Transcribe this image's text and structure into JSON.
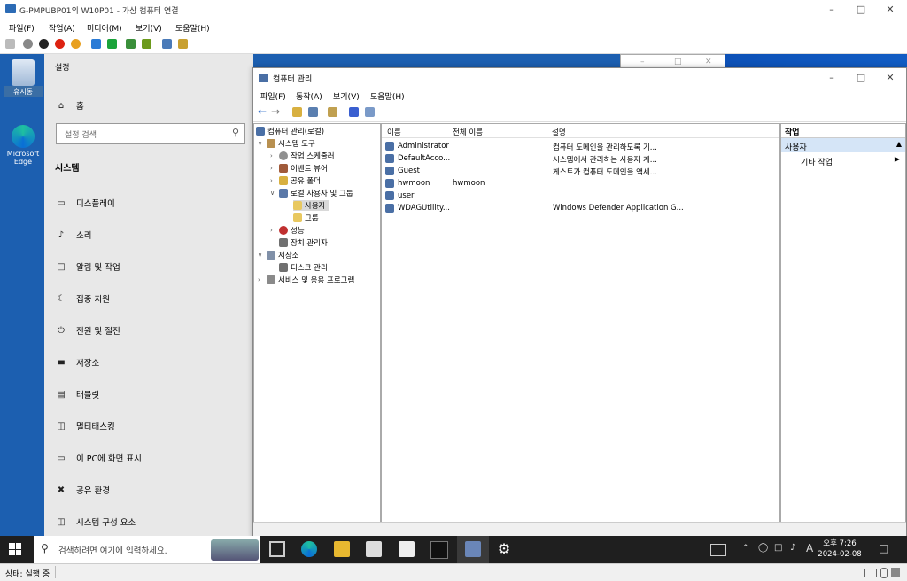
{
  "vm": {
    "title": "G-PMPUBP01의 W10P01 - 가상 컴퓨터 연결",
    "menus": [
      "파일(F)",
      "작업(A)",
      "미디어(M)",
      "보기(V)",
      "도움말(H)"
    ],
    "status": "상태: 실행 중"
  },
  "desktop": {
    "icons": [
      {
        "label": "휴지통"
      },
      {
        "label": "Microsoft Edge"
      }
    ]
  },
  "settings": {
    "title": "설정",
    "home": "홈",
    "search_placeholder": "설정 검색",
    "section": "시스템",
    "items": [
      {
        "label": "디스플레이",
        "icon": "monitor-icon"
      },
      {
        "label": "소리",
        "icon": "speaker-icon"
      },
      {
        "label": "알림 및 작업",
        "icon": "notification-icon"
      },
      {
        "label": "집중 지원",
        "icon": "moon-icon"
      },
      {
        "label": "전원 및 절전",
        "icon": "power-icon"
      },
      {
        "label": "저장소",
        "icon": "storage-icon"
      },
      {
        "label": "태블릿",
        "icon": "tablet-icon"
      },
      {
        "label": "멀티태스킹",
        "icon": "multitask-icon"
      },
      {
        "label": "이 PC에 화면 표시",
        "icon": "project-icon"
      },
      {
        "label": "공유 환경",
        "icon": "share-icon"
      },
      {
        "label": "시스템 구성 요소",
        "icon": "components-icon"
      }
    ]
  },
  "cm": {
    "title": "컴퓨터 관리",
    "menus": [
      "파일(F)",
      "동작(A)",
      "보기(V)",
      "도움말(H)"
    ],
    "tree": [
      {
        "label": "컴퓨터 관리(로컬)",
        "level": 0,
        "expander": ""
      },
      {
        "label": "시스템 도구",
        "level": 1,
        "expander": "v"
      },
      {
        "label": "작업 스케줄러",
        "level": 2,
        "expander": ">"
      },
      {
        "label": "이벤트 뷰어",
        "level": 2,
        "expander": ">"
      },
      {
        "label": "공유 폴더",
        "level": 2,
        "expander": ">"
      },
      {
        "label": "로컬 사용자 및 그룹",
        "level": 2,
        "expander": "v"
      },
      {
        "label": "사용자",
        "level": 3,
        "expander": "",
        "selected": true
      },
      {
        "label": "그룹",
        "level": 3,
        "expander": ""
      },
      {
        "label": "성능",
        "level": 2,
        "expander": ">"
      },
      {
        "label": "장치 관리자",
        "level": 2,
        "expander": ""
      },
      {
        "label": "저장소",
        "level": 1,
        "expander": "v"
      },
      {
        "label": "디스크 관리",
        "level": 2,
        "expander": ""
      },
      {
        "label": "서비스 및 응용 프로그램",
        "level": 1,
        "expander": ">"
      }
    ],
    "columns": [
      "이름",
      "전체 이름",
      "설명"
    ],
    "rows": [
      {
        "name": "Administrator",
        "full": "",
        "desc": "컴퓨터 도메인을 관리하도록 기..."
      },
      {
        "name": "DefaultAcco...",
        "full": "",
        "desc": "시스템에서 관리하는 사용자 계..."
      },
      {
        "name": "Guest",
        "full": "",
        "desc": "게스트가 컴퓨터 도메인을 액세..."
      },
      {
        "name": "hwmoon",
        "full": "hwmoon",
        "desc": ""
      },
      {
        "name": "user",
        "full": "",
        "desc": ""
      },
      {
        "name": "WDAGUtility...",
        "full": "",
        "desc": "Windows Defender Application G..."
      }
    ],
    "actions": {
      "header": "작업",
      "section": "사용자",
      "item": "기타 작업"
    }
  },
  "taskbar": {
    "search_placeholder": "검색하려면 여기에 입력하세요.",
    "time": "오후 7:26",
    "date": "2024-02-08",
    "ime": "A"
  }
}
